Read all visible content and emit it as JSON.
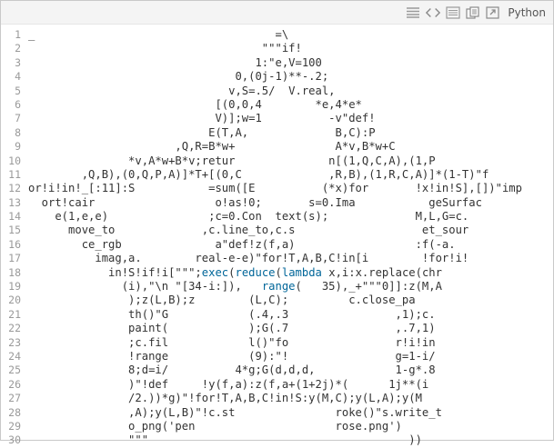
{
  "toolbar": {
    "icons": [
      "menu-lines-icon",
      "code-brackets-icon",
      "list-icon",
      "copy-icon",
      "open-external-icon"
    ],
    "language": "Python"
  },
  "editor": {
    "line_numbers": [
      "1",
      "2",
      "3",
      "4",
      "5",
      "6",
      "7",
      "8",
      "9",
      "10",
      "11",
      "12",
      "13",
      "14",
      "15",
      "16",
      "17",
      "18",
      "19",
      "20",
      "21",
      "22",
      "23",
      "24",
      "25",
      "26",
      "27",
      "28",
      "29",
      "30"
    ],
    "lines": [
      "_                                    =\\",
      "                                   \"\"\"if!",
      "                                  1:\"e,V=100",
      "                               0,(0j-1)**-.2;",
      "                              v,S=.5/  V.real,",
      "                            [(0,0,4        *e,4*e*",
      "                            V)];w=1          -v\"def!",
      "                           E(T,A,             B,C):P",
      "                      ,Q,R=B*w+               A*v,B*w+C",
      "               *v,A*w+B*v;retur              n[(1,Q,C,A),(1,P",
      "        ,Q,B),(0,Q,P,A)]*T+[(0,C             ,R,B),(1,R,C,A)]*(1-T)\"f",
      "or!i!in!_[:11]:S           =sum([E          (*x)for       !x!in!S],[])\"imp",
      "  ort!cair                  o!as!0;       s=0.Ima           geSurfac",
      "    e(1,e,e)               ;c=0.Con  text(s);             M,L,G=c.",
      "      move_to             ,c.line_to,c.s                   et_sour",
      "        ce_rgb              a\"def!z(f,a)                  :f(-a.",
      "          imag,a.        real-e-e)\"for!T,A,B,C!in[i        !for!i!",
      "            in!S!if!i[\"\"\";exec(reduce(lambda x,i:x.replace(chr",
      "              (i),\"\\n \"[34-i:]),   range(   35),_+\"\"\"0]]:z(M,A",
      "               );z(L,B);z        (L,C);         c.close_pa",
      "               th()\"G            (.4,.3                ,1);c.",
      "               paint(            );G(.7                ,.7,1)",
      "               ;c.fil            l()\"fo                r!i!in",
      "               !range            (9):\"!                g=1-i/",
      "               8;d=i/          4*g;G(d,d,d,            1-g*.8",
      "               )\"!def     !y(f,a):z(f,a+(1+2j)*(      1j**(i",
      "               /2.))*g)\"!for!T,A,B,C!in!S:y(M,C);y(L,A);y(M",
      "               ,A);y(L,B)\"!c.st               roke()\"s.write_t",
      "               o_png('pen                     rose.png')",
      "               \"\"\"                                       ))"
    ]
  }
}
